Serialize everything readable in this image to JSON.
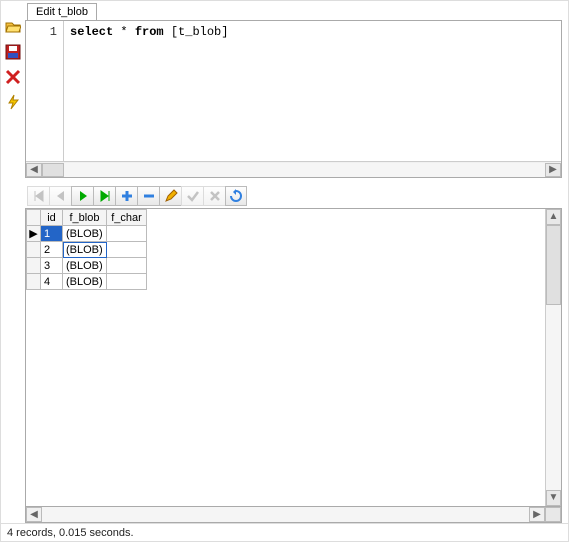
{
  "tab": {
    "label": "Edit t_blob"
  },
  "editor": {
    "line_no": "1",
    "sql_kw1": "select",
    "sql_mid": " * ",
    "sql_kw2": "from",
    "sql_tail": " [t_blob]"
  },
  "grid": {
    "headers": {
      "rowhead": "",
      "id": "id",
      "f_blob": "f_blob",
      "f_char": "f_char"
    },
    "rows": [
      {
        "marker": "▶",
        "id": "1",
        "f_blob": "(BLOB)",
        "f_char": ""
      },
      {
        "marker": "",
        "id": "2",
        "f_blob": "(BLOB)",
        "f_char": ""
      },
      {
        "marker": "",
        "id": "3",
        "f_blob": "(BLOB)",
        "f_char": ""
      },
      {
        "marker": "",
        "id": "4",
        "f_blob": "(BLOB)",
        "f_char": ""
      }
    ]
  },
  "status": {
    "text": "4 records, 0.015 seconds."
  }
}
